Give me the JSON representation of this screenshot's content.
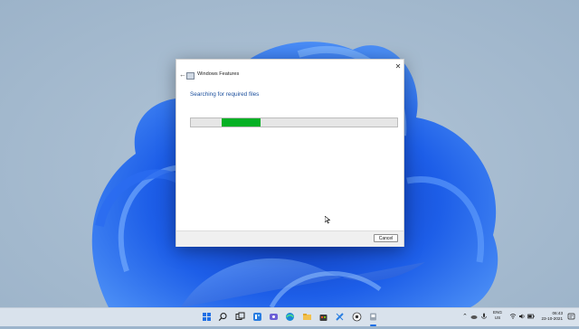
{
  "dialog": {
    "title": "Windows Features",
    "heading": "Searching for required files",
    "progress_fraction": 0.19,
    "progress_offset_fraction": 0.15,
    "cancel_label": "Cancel"
  },
  "taskbar": {
    "icons": [
      "start-icon",
      "search-icon",
      "task-view-icon",
      "widgets-icon",
      "chat-icon",
      "edge-icon",
      "file-explorer-icon",
      "store-icon",
      "settings-icon",
      "chrome-icon",
      "app-icon"
    ],
    "lang_line1": "ENG",
    "lang_line2": "US",
    "time": "06:43",
    "date": "23-10-2021"
  },
  "colors": {
    "accent": "#1a4e9c",
    "progress": "#06b025",
    "bloom": "#1f5fe0"
  }
}
